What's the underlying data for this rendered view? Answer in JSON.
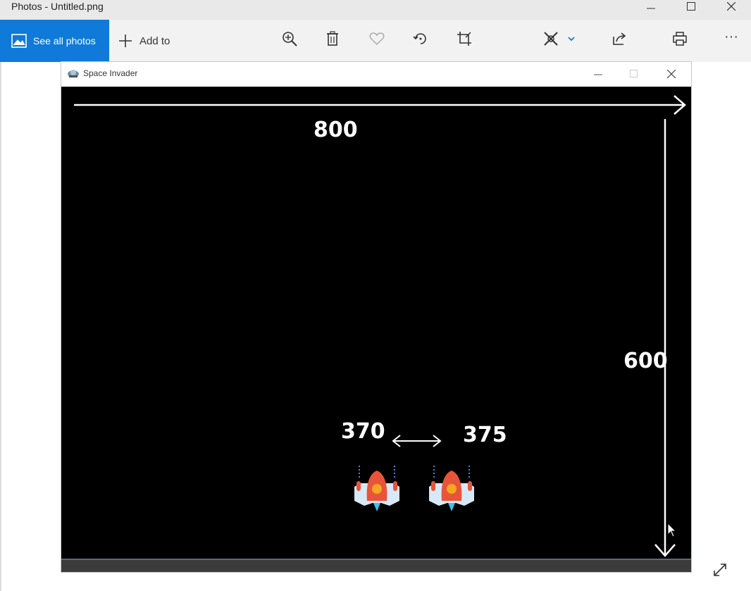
{
  "app": {
    "title": "Photos - Untitled.png"
  },
  "toolbar": {
    "see_all_label": "See all photos",
    "add_to_label": "Add to",
    "more_label": "···",
    "icons": [
      "zoom-in-icon",
      "delete-icon",
      "favorite-icon",
      "rotate-icon",
      "crop-icon",
      "edit-draw-icon",
      "share-icon",
      "print-icon"
    ],
    "accent": "#0f7ad8"
  },
  "game_window": {
    "title": "Space Invader"
  },
  "annotations": {
    "width_label": "800",
    "height_label": "600",
    "pos_left_label": "370",
    "pos_right_label": "375"
  },
  "colors": {
    "game_bg": "#000000",
    "annotation": "#ffffff"
  }
}
